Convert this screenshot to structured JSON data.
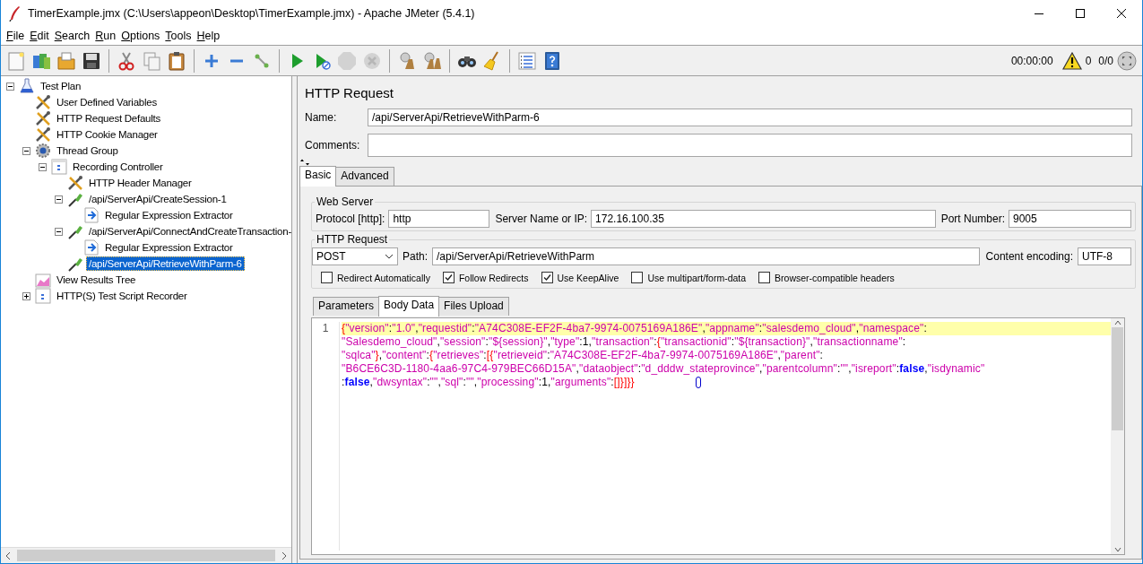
{
  "window": {
    "title": "TimerExample.jmx (C:\\Users\\appeon\\Desktop\\TimerExample.jmx) - Apache JMeter (5.4.1)"
  },
  "menu": [
    "File",
    "Edit",
    "Search",
    "Run",
    "Options",
    "Tools",
    "Help"
  ],
  "toolbar": [
    {
      "kind": "new",
      "disabled": false
    },
    {
      "kind": "templates",
      "disabled": false
    },
    {
      "kind": "open",
      "disabled": false
    },
    {
      "kind": "save",
      "disabled": false
    },
    {
      "kind": "separator"
    },
    {
      "kind": "cut",
      "disabled": false
    },
    {
      "kind": "copy",
      "disabled": false
    },
    {
      "kind": "paste",
      "disabled": false
    },
    {
      "kind": "separator"
    },
    {
      "kind": "expand",
      "disabled": false
    },
    {
      "kind": "collapse",
      "disabled": false
    },
    {
      "kind": "toggle",
      "disabled": false
    },
    {
      "kind": "separator"
    },
    {
      "kind": "start",
      "disabled": false
    },
    {
      "kind": "start-no-pause",
      "disabled": false
    },
    {
      "kind": "stop",
      "disabled": true
    },
    {
      "kind": "shutdown",
      "disabled": true
    },
    {
      "kind": "separator"
    },
    {
      "kind": "clear",
      "disabled": false
    },
    {
      "kind": "clear-all",
      "disabled": false
    },
    {
      "kind": "separator"
    },
    {
      "kind": "search",
      "disabled": false
    },
    {
      "kind": "broom",
      "disabled": false
    },
    {
      "kind": "separator"
    },
    {
      "kind": "list",
      "disabled": false
    },
    {
      "kind": "help",
      "disabled": false
    }
  ],
  "status": {
    "elapsed": "00:00:00",
    "warnings": "0",
    "threads": "0/0"
  },
  "tree": [
    {
      "label": "Test Plan",
      "kind": "plan",
      "expanded": true,
      "selected": false,
      "children": [
        {
          "label": "User Defined Variables",
          "kind": "config",
          "selected": false
        },
        {
          "label": "HTTP Request Defaults",
          "kind": "config",
          "selected": false
        },
        {
          "label": "HTTP Cookie Manager",
          "kind": "config",
          "selected": false
        },
        {
          "label": "Thread Group",
          "kind": "thread",
          "expanded": true,
          "selected": false,
          "children": [
            {
              "label": "Recording Controller",
              "kind": "controller",
              "expanded": true,
              "selected": false,
              "children": [
                {
                  "label": "HTTP Header Manager",
                  "kind": "config",
                  "selected": false
                },
                {
                  "label": "/api/ServerApi/CreateSession-1",
                  "kind": "sampler",
                  "expanded": true,
                  "selected": false,
                  "children": [
                    {
                      "label": "Regular Expression Extractor",
                      "kind": "extractor",
                      "selected": false
                    }
                  ]
                },
                {
                  "label": "/api/ServerApi/ConnectAndCreateTransaction-",
                  "kind": "sampler",
                  "expanded": true,
                  "selected": false,
                  "children": [
                    {
                      "label": "Regular Expression Extractor",
                      "kind": "extractor",
                      "selected": false
                    }
                  ]
                },
                {
                  "label": "/api/ServerApi/RetrieveWithParm-6",
                  "kind": "sampler",
                  "selected": true
                }
              ]
            }
          ]
        },
        {
          "label": "View Results Tree",
          "kind": "listener",
          "selected": false
        },
        {
          "label": "HTTP(S) Test Script Recorder",
          "kind": "recorder",
          "expanded": false,
          "selected": false
        }
      ]
    }
  ],
  "panel": {
    "title": "HTTP Request",
    "name_label": "Name:",
    "name": "/api/ServerApi/RetrieveWithParm-6",
    "comments_label": "Comments:",
    "tabs": [
      {
        "label": "Basic",
        "selected": true
      },
      {
        "label": "Advanced",
        "selected": false
      }
    ],
    "web_server": {
      "legend": "Web Server",
      "fields": [
        {
          "label": "Protocol [http]:",
          "value": "http"
        },
        {
          "label": "Server Name or IP:",
          "value": "172.16.100.35"
        },
        {
          "label": "Port Number:",
          "value": "9005"
        }
      ]
    },
    "http_request": {
      "legend": "HTTP Request",
      "method": "POST",
      "path_label": "Path:",
      "path": "/api/ServerApi/RetrieveWithParm",
      "encoding_label": "Content encoding:",
      "encoding": "UTF-8",
      "options": [
        {
          "label": "Redirect Automatically",
          "checked": false
        },
        {
          "label": "Follow Redirects",
          "checked": true
        },
        {
          "label": "Use KeepAlive",
          "checked": true
        },
        {
          "label": "Use multipart/form-data",
          "checked": false
        },
        {
          "label": "Browser-compatible headers",
          "checked": false
        }
      ]
    },
    "body_tabs": [
      {
        "label": "Parameters",
        "selected": false
      },
      {
        "label": "Body Data",
        "selected": true
      },
      {
        "label": "Files Upload",
        "selected": false
      }
    ],
    "editor": {
      "line_number": "1",
      "lines": [
        [
          {
            "kind": "brace",
            "text": "{"
          },
          {
            "kind": "string",
            "text": "\"version\""
          },
          {
            "kind": "punct",
            "text": ":"
          },
          {
            "kind": "string",
            "text": "\"1.0\""
          },
          {
            "kind": "punct",
            "text": ","
          },
          {
            "kind": "string",
            "text": "\"requestid\""
          },
          {
            "kind": "punct",
            "text": ":"
          },
          {
            "kind": "string",
            "text": "\"A74C308E-EF2F-4ba7-9974-0075169A186E\""
          },
          {
            "kind": "punct",
            "text": ","
          },
          {
            "kind": "string",
            "text": "\"appname\""
          },
          {
            "kind": "punct",
            "text": ":"
          },
          {
            "kind": "string",
            "text": "\"salesdemo_cloud\""
          },
          {
            "kind": "punct",
            "text": ","
          },
          {
            "kind": "string",
            "text": "\"namespace\""
          },
          {
            "kind": "punct",
            "text": ":"
          }
        ],
        [
          {
            "kind": "string",
            "text": "\"Salesdemo_cloud\""
          },
          {
            "kind": "punct",
            "text": ","
          },
          {
            "kind": "string",
            "text": "\"session\""
          },
          {
            "kind": "punct",
            "text": ":"
          },
          {
            "kind": "string",
            "text": "\"${session}\""
          },
          {
            "kind": "punct",
            "text": ","
          },
          {
            "kind": "string",
            "text": "\"type\""
          },
          {
            "kind": "punct",
            "text": ":"
          },
          {
            "kind": "number",
            "text": "1"
          },
          {
            "kind": "punct",
            "text": ","
          },
          {
            "kind": "string",
            "text": "\"transaction\""
          },
          {
            "kind": "punct",
            "text": ":"
          },
          {
            "kind": "brace",
            "text": "{"
          },
          {
            "kind": "string",
            "text": "\"transactionid\""
          },
          {
            "kind": "punct",
            "text": ":"
          },
          {
            "kind": "string",
            "text": "\"${transaction}\""
          },
          {
            "kind": "punct",
            "text": ","
          },
          {
            "kind": "string",
            "text": "\"transactionname\""
          },
          {
            "kind": "punct",
            "text": ":"
          }
        ],
        [
          {
            "kind": "string",
            "text": "\"sqlca\""
          },
          {
            "kind": "brace",
            "text": "}"
          },
          {
            "kind": "punct",
            "text": ","
          },
          {
            "kind": "string",
            "text": "\"content\""
          },
          {
            "kind": "punct",
            "text": ":"
          },
          {
            "kind": "brace",
            "text": "{"
          },
          {
            "kind": "string",
            "text": "\"retrieves\""
          },
          {
            "kind": "punct",
            "text": ":"
          },
          {
            "kind": "brace",
            "text": "[{"
          },
          {
            "kind": "string",
            "text": "\"retrieveid\""
          },
          {
            "kind": "punct",
            "text": ":"
          },
          {
            "kind": "string",
            "text": "\"A74C308E-EF2F-4ba7-9974-0075169A186E\""
          },
          {
            "kind": "punct",
            "text": ","
          },
          {
            "kind": "string",
            "text": "\"parent\""
          },
          {
            "kind": "punct",
            "text": ":"
          }
        ],
        [
          {
            "kind": "string",
            "text": "\"B6CE6C3D-1180-4aa6-97C4-979BEC66D15A\""
          },
          {
            "kind": "punct",
            "text": ","
          },
          {
            "kind": "string",
            "text": "\"dataobject\""
          },
          {
            "kind": "punct",
            "text": ":"
          },
          {
            "kind": "string",
            "text": "\"d_dddw_stateprovince\""
          },
          {
            "kind": "punct",
            "text": ","
          },
          {
            "kind": "string",
            "text": "\"parentcolumn\""
          },
          {
            "kind": "punct",
            "text": ":"
          },
          {
            "kind": "string",
            "text": "\"\""
          },
          {
            "kind": "punct",
            "text": ","
          },
          {
            "kind": "string",
            "text": "\"isreport\""
          },
          {
            "kind": "punct",
            "text": ":"
          },
          {
            "kind": "keyword",
            "text": "false"
          },
          {
            "kind": "punct",
            "text": ","
          },
          {
            "kind": "string",
            "text": "\"isdynamic\""
          }
        ],
        [
          {
            "kind": "punct",
            "text": ":"
          },
          {
            "kind": "keyword",
            "text": "false"
          },
          {
            "kind": "punct",
            "text": ","
          },
          {
            "kind": "string",
            "text": "\"dwsyntax\""
          },
          {
            "kind": "punct",
            "text": ":"
          },
          {
            "kind": "string",
            "text": "\"\""
          },
          {
            "kind": "punct",
            "text": ","
          },
          {
            "kind": "string",
            "text": "\"sql\""
          },
          {
            "kind": "punct",
            "text": ":"
          },
          {
            "kind": "string",
            "text": "\"\""
          },
          {
            "kind": "punct",
            "text": ","
          },
          {
            "kind": "string",
            "text": "\"processing\""
          },
          {
            "kind": "punct",
            "text": ":"
          },
          {
            "kind": "number",
            "text": "1"
          },
          {
            "kind": "punct",
            "text": ","
          },
          {
            "kind": "string",
            "text": "\"arguments\""
          },
          {
            "kind": "punct",
            "text": ":"
          },
          {
            "kind": "brace",
            "text": "[]}]}}"
          }
        ]
      ]
    }
  }
}
